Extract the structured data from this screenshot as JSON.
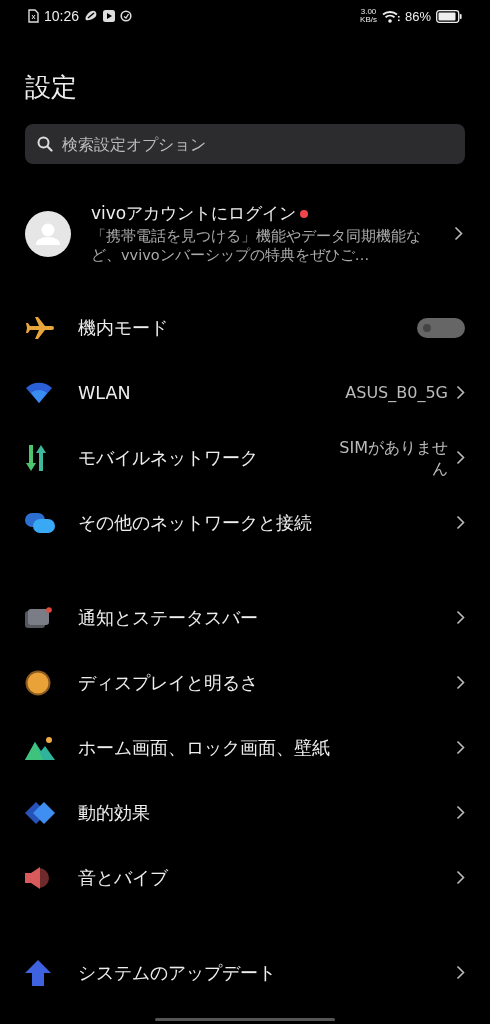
{
  "status_bar": {
    "time": "10:26",
    "speed": "3.00",
    "speed_unit": "KB/s",
    "battery": "86%"
  },
  "title": "設定",
  "search": {
    "placeholder": "検索設定オプション"
  },
  "account": {
    "name": "vivoアカウントにログイン",
    "unread": true,
    "description": "「携帯電話を見つける」機能やデータ同期機能など、vvivoンバーシップの特典をぜひご…"
  },
  "groups": [
    {
      "items": [
        {
          "kind": "toggle",
          "label": "機内モード",
          "on": false
        },
        {
          "kind": "link",
          "label": "WLAN",
          "value": "ASUS_B0_5G"
        },
        {
          "kind": "link",
          "label": "モバイルネットワーク",
          "value": "SIMがありません"
        },
        {
          "kind": "link",
          "label": "その他のネットワークと接続"
        }
      ]
    },
    {
      "items": [
        {
          "kind": "link",
          "label": "通知とステータスバー"
        },
        {
          "kind": "link",
          "label": "ディスプレイと明るさ"
        },
        {
          "kind": "link",
          "label": "ホーム画面、ロック画面、壁紙"
        },
        {
          "kind": "link",
          "label": "動的効果"
        },
        {
          "kind": "link",
          "label": "音とバイブ"
        }
      ]
    },
    {
      "items": [
        {
          "kind": "link",
          "label": "システムのアップデート"
        }
      ]
    }
  ]
}
